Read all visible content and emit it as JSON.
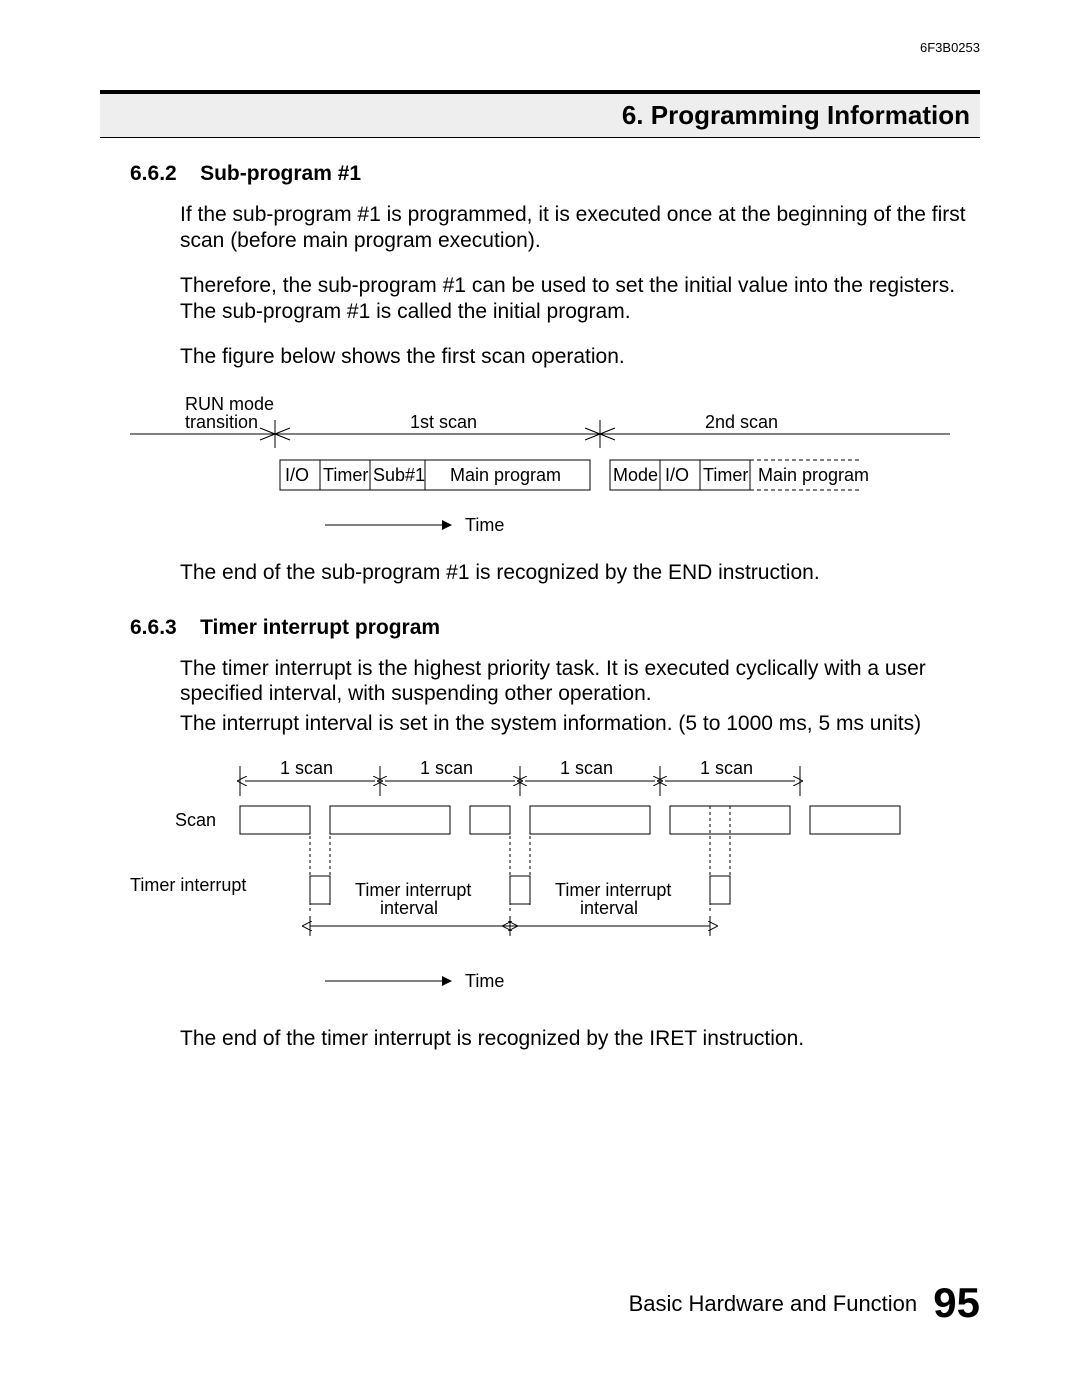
{
  "doc_id": "6F3B0253",
  "chapter_title": "6. Programming Information",
  "sec1": {
    "num": "6.6.2",
    "title": "Sub-program #1",
    "p1": "If the sub-program #1 is programmed, it is executed once at the beginning of the first scan (before main program execution).",
    "p2": "Therefore, the sub-program #1 can be used to set the initial value into the registers. The sub-program #1 is called the initial program.",
    "p3": "The figure below shows the first scan operation.",
    "p4": "The end of the sub-program #1 is recognized by the END instruction."
  },
  "fig1": {
    "run_mode": "RUN mode",
    "transition": "transition",
    "first_scan": "1st scan",
    "second_scan": "2nd scan",
    "io": "I/O",
    "timer": "Timer",
    "sub1": "Sub#1",
    "main": "Main program",
    "mode": "Mode",
    "time": "Time"
  },
  "sec2": {
    "num": "6.6.3",
    "title": "Timer interrupt program",
    "p1": "The timer interrupt is the highest priority task. It is executed cyclically with a user specified interval, with suspending other operation.",
    "p2": "The interrupt interval is set in the system information. (5 to 1000 ms, 5 ms units)",
    "p3": "The end of the timer interrupt is recognized by the IRET instruction."
  },
  "fig2": {
    "one_scan": "1 scan",
    "scan": "Scan",
    "timer_interrupt": "Timer interrupt",
    "ti_interval_l1": "Timer interrupt",
    "ti_interval_l2": "interval",
    "time": "Time"
  },
  "footer": {
    "text": "Basic Hardware and Function",
    "page": "95"
  }
}
